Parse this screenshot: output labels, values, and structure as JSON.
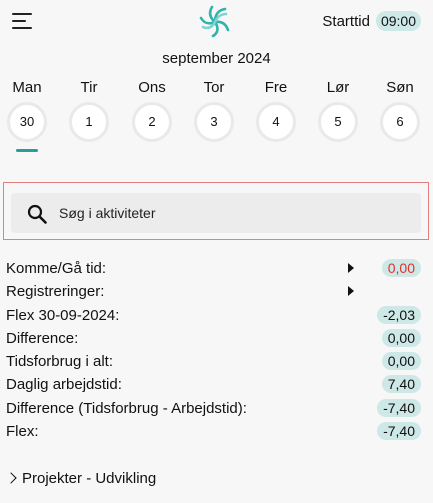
{
  "header": {
    "menu_icon": "hamburger-menu-icon",
    "logo_icon": "swirl-logo-icon",
    "start_label": "Starttid",
    "start_time": "09:00",
    "accent_color": "#2a9d98"
  },
  "month_label": "september 2024",
  "days": [
    {
      "name": "Man",
      "date": "30",
      "selected": true
    },
    {
      "name": "Tir",
      "date": "1"
    },
    {
      "name": "Ons",
      "date": "2"
    },
    {
      "name": "Tor",
      "date": "3"
    },
    {
      "name": "Fre",
      "date": "4"
    },
    {
      "name": "Lør",
      "date": "5"
    },
    {
      "name": "Søn",
      "date": "6"
    }
  ],
  "search": {
    "placeholder": "Søg i aktiviteter",
    "icon": "search-icon"
  },
  "summary": [
    {
      "label": "Komme/Gå tid:",
      "value": "0,00",
      "arrow": true,
      "value_color": "#e0312f"
    },
    {
      "label": "Registreringer:",
      "value": "",
      "arrow": true
    },
    {
      "label": "Flex 30-09-2024:",
      "value": "-2,03"
    },
    {
      "label": "Difference:",
      "value": "0,00"
    },
    {
      "label": "Tidsforbrug i alt:",
      "value": "0,00"
    },
    {
      "label": "Daglig arbejdstid:",
      "value": "7,40"
    },
    {
      "label": "Difference (Tidsforbrug - Arbejdstid):",
      "value": "-7,40"
    },
    {
      "label": "Flex:",
      "value": "-7,40"
    }
  ],
  "projects_label": "Projekter - Udvikling",
  "badge_color": "#cde8e6"
}
